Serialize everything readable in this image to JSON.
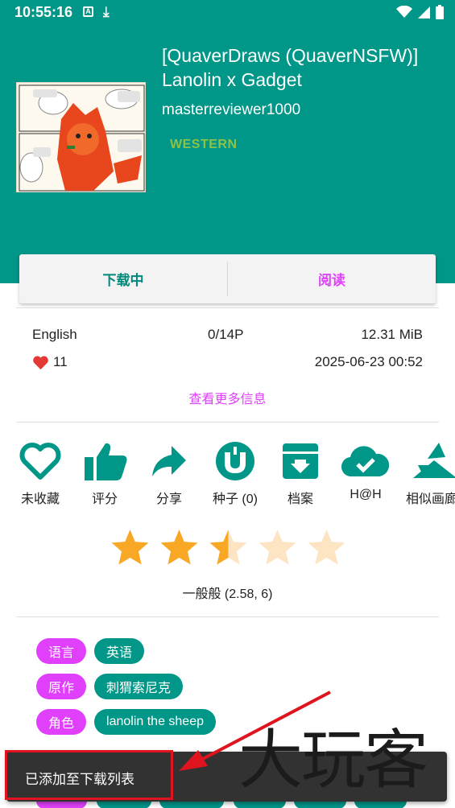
{
  "status_bar": {
    "time": "10:55:16",
    "badge": "A"
  },
  "gallery": {
    "title": "[QuaverDraws (QuaverNSFW)] Lanolin x Gadget",
    "uploader": "masterreviewer1000",
    "category": "WESTERN",
    "category_color": "#8bc34a"
  },
  "actions": {
    "download": "下载中",
    "read": "阅读"
  },
  "info": {
    "language": "English",
    "pages": "0/14P",
    "size": "12.31 MiB",
    "favorites": "11",
    "posted": "2025-06-23 00:52",
    "more": "查看更多信息"
  },
  "toolbar": [
    {
      "icon": "heart-outline-icon",
      "label": "未收藏"
    },
    {
      "icon": "thumbs-up-icon",
      "label": "评分"
    },
    {
      "icon": "share-icon",
      "label": "分享"
    },
    {
      "icon": "torrent-icon",
      "label": "种子 (0)"
    },
    {
      "icon": "archive-icon",
      "label": "档案"
    },
    {
      "icon": "cloud-done-icon",
      "label": "H@H"
    },
    {
      "icon": "similar-icon",
      "label": "相似画廊"
    }
  ],
  "rating": {
    "value": 2.58,
    "count": 6,
    "text": "一般般 (2.58, 6)"
  },
  "tags": [
    {
      "namespace": "语言",
      "values": [
        "英语"
      ]
    },
    {
      "namespace": "原作",
      "values": [
        "刺猬索尼克"
      ]
    },
    {
      "namespace": "角色",
      "values": [
        "lanolin the sheep"
      ]
    }
  ],
  "snackbar": {
    "message": "已添加至下载列表"
  },
  "watermark": "大玩客",
  "colors": {
    "primary": "#009688",
    "accent": "#e040fb",
    "star": "#f9a825",
    "highlight": "#e0141e"
  }
}
